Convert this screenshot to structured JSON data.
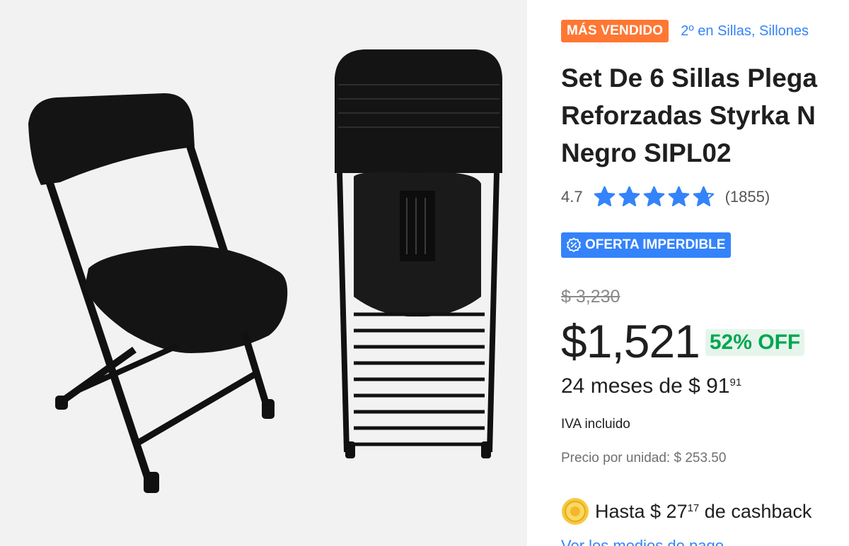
{
  "product": {
    "badge": "MÁS VENDIDO",
    "rank": "2º en Sillas, Sillones",
    "title_lines": [
      "Set De 6 Sillas Plega",
      "Reforzadas Styrka N",
      "Negro SIPL02"
    ],
    "rating": "4.7",
    "rating_stars": 4.7,
    "reviews": "(1855)",
    "deal_label": "OFERTA IMPERDIBLE",
    "old_price": "$ 3,230",
    "price": "$1,521",
    "discount": "52% OFF",
    "installments_text": "24 meses de $ 91",
    "installments_cents": "91",
    "tax_note": "IVA incluido",
    "unit_price": "Precio por unidad: $ 253.50",
    "cashback_prefix": "Hasta $ 27",
    "cashback_cents": "17",
    "cashback_suffix": " de cashback",
    "cut_link": "Ver los medios de pago"
  },
  "icons": {
    "star": "star-icon",
    "deal": "percent-badge-icon",
    "coin": "coin-icon"
  },
  "colors": {
    "accent_blue": "#3483fa",
    "badge_orange": "#ff7733",
    "discount_green": "#00a650",
    "discount_bg": "#e5f5ec"
  }
}
